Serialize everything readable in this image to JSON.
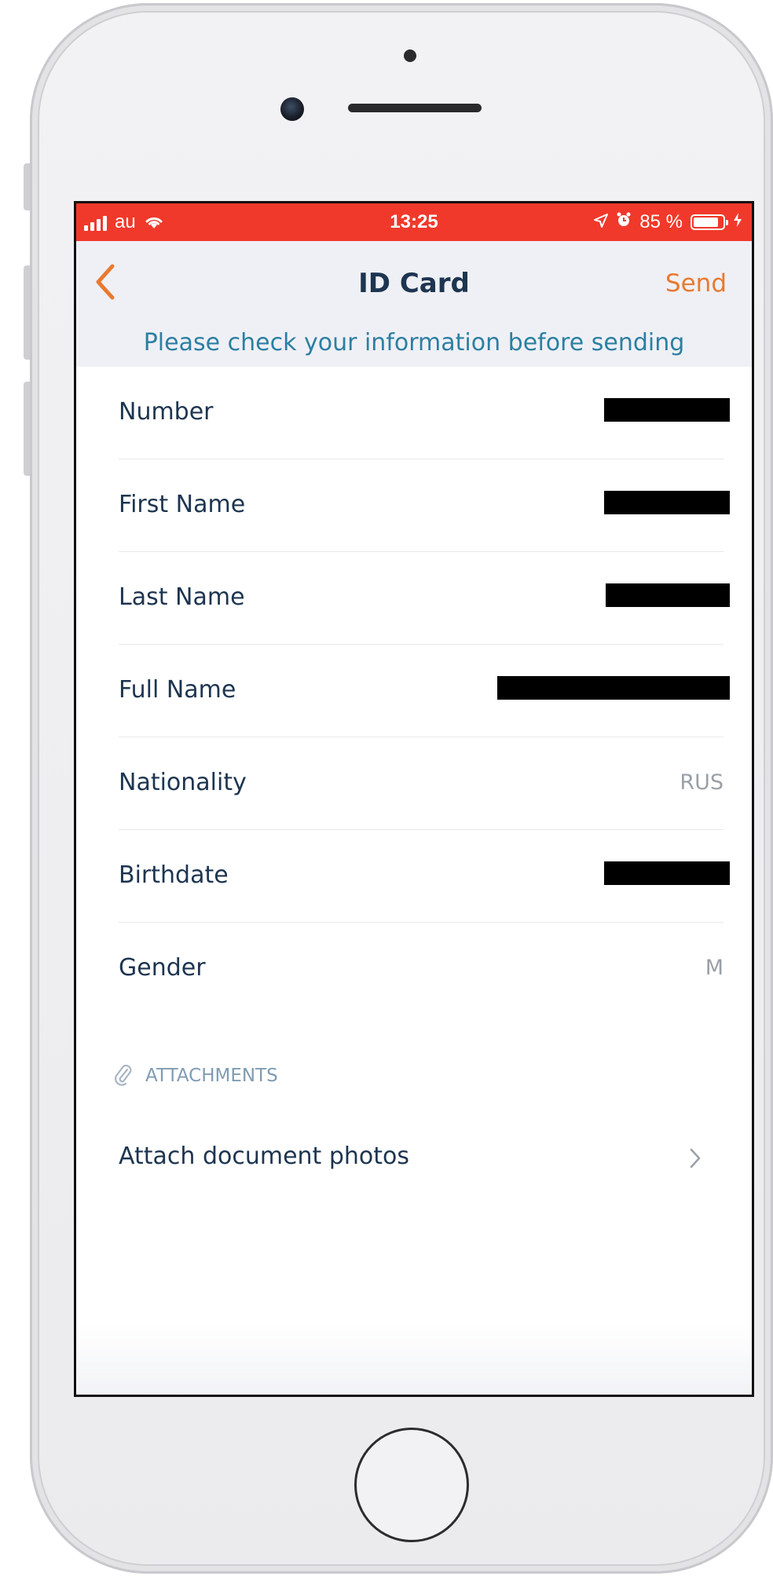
{
  "status_bar": {
    "carrier": "au",
    "time": "13:25",
    "battery_percent": "85 %",
    "battery_level": 0.85
  },
  "nav": {
    "title": "ID Card",
    "send_label": "Send",
    "back_icon": "chevron-left-icon"
  },
  "notice": "Please check your information before sending",
  "fields": [
    {
      "label": "Number",
      "value": "",
      "redacted": true
    },
    {
      "label": "First Name",
      "value": "",
      "redacted": true
    },
    {
      "label": "Last Name",
      "value": "",
      "redacted": true
    },
    {
      "label": "Full Name",
      "value": "",
      "redacted": true
    },
    {
      "label": "Nationality",
      "value": "RUS",
      "redacted": false
    },
    {
      "label": "Birthdate",
      "value": "",
      "redacted": true
    },
    {
      "label": "Gender",
      "value": "M",
      "redacted": false
    }
  ],
  "attachments": {
    "header": "ATTACHMENTS",
    "icon": "paperclip-icon",
    "row_label": "Attach document photos",
    "row_icon": "chevron-right-icon"
  },
  "colors": {
    "status_bar": "#f0392b",
    "accent": "#e87a30",
    "notice_text": "#2c7fa2",
    "label_text": "#1d3550"
  }
}
